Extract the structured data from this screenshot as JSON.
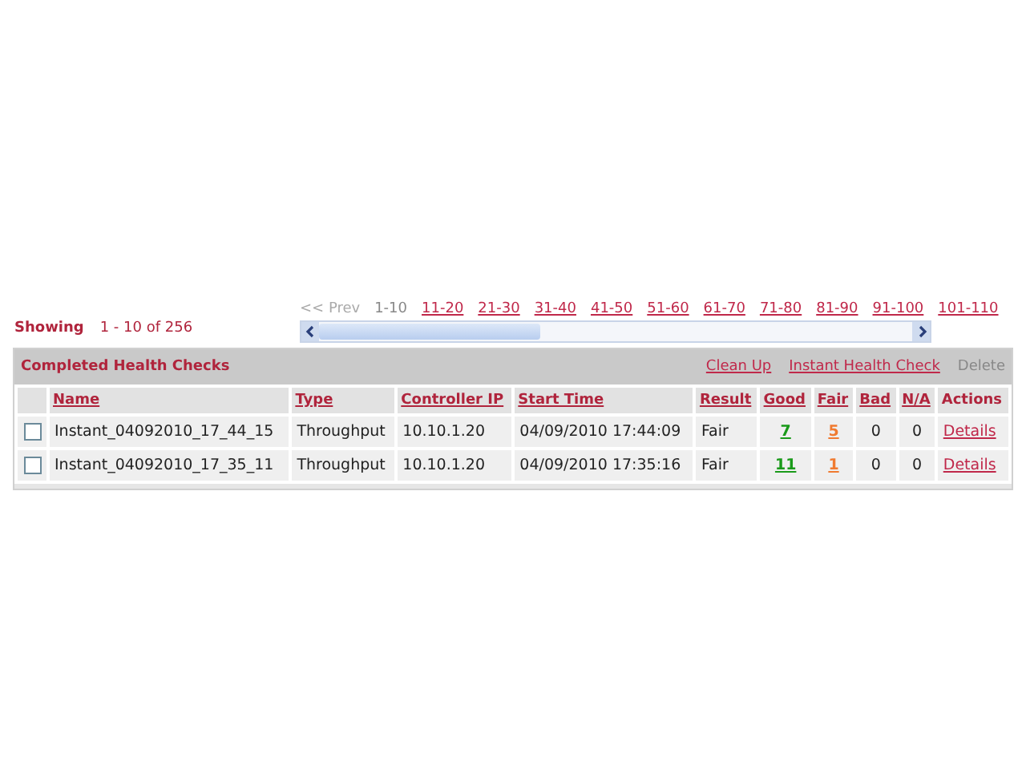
{
  "showing": {
    "label": "Showing",
    "range": "1 - 10 of 256"
  },
  "pagination": {
    "prev": {
      "label": "<< Prev",
      "disabled": true
    },
    "pages": [
      {
        "label": "1-10",
        "selected": true
      },
      {
        "label": "11-20",
        "selected": false
      },
      {
        "label": "21-30",
        "selected": false
      },
      {
        "label": "31-40",
        "selected": false
      },
      {
        "label": "41-50",
        "selected": false
      },
      {
        "label": "51-60",
        "selected": false
      },
      {
        "label": "61-70",
        "selected": false
      },
      {
        "label": "71-80",
        "selected": false
      },
      {
        "label": "81-90",
        "selected": false
      },
      {
        "label": "91-100",
        "selected": false
      },
      {
        "label": "101-110",
        "selected": false
      }
    ]
  },
  "panel": {
    "title": "Completed Health Checks",
    "actions": [
      {
        "label": "Clean Up",
        "disabled": false
      },
      {
        "label": "Instant Health Check",
        "disabled": false
      },
      {
        "label": "Delete",
        "disabled": true
      }
    ]
  },
  "table": {
    "columns": [
      {
        "label": "Name",
        "kind": "link"
      },
      {
        "label": "Type",
        "kind": "link"
      },
      {
        "label": "Controller IP",
        "kind": "link"
      },
      {
        "label": "Start Time",
        "kind": "link"
      },
      {
        "label": "Result",
        "kind": "link"
      },
      {
        "label": "Good",
        "kind": "link"
      },
      {
        "label": "Fair",
        "kind": "link"
      },
      {
        "label": "Bad",
        "kind": "link"
      },
      {
        "label": "N/A",
        "kind": "link"
      },
      {
        "label": "Actions",
        "kind": "plain"
      }
    ],
    "rows": [
      {
        "checked": false,
        "name": "Instant_04092010_17_44_15",
        "type": "Throughput",
        "controller_ip": "10.10.1.20",
        "start_time": "04/09/2010 17:44:09",
        "result": "Fair",
        "good": "7",
        "fair": "5",
        "bad": "0",
        "na": "0",
        "action": "Details"
      },
      {
        "checked": false,
        "name": "Instant_04092010_17_35_11",
        "type": "Throughput",
        "controller_ip": "10.10.1.20",
        "start_time": "04/09/2010 17:35:16",
        "result": "Fair",
        "good": "11",
        "fair": "1",
        "bad": "0",
        "na": "0",
        "action": "Details"
      }
    ]
  }
}
